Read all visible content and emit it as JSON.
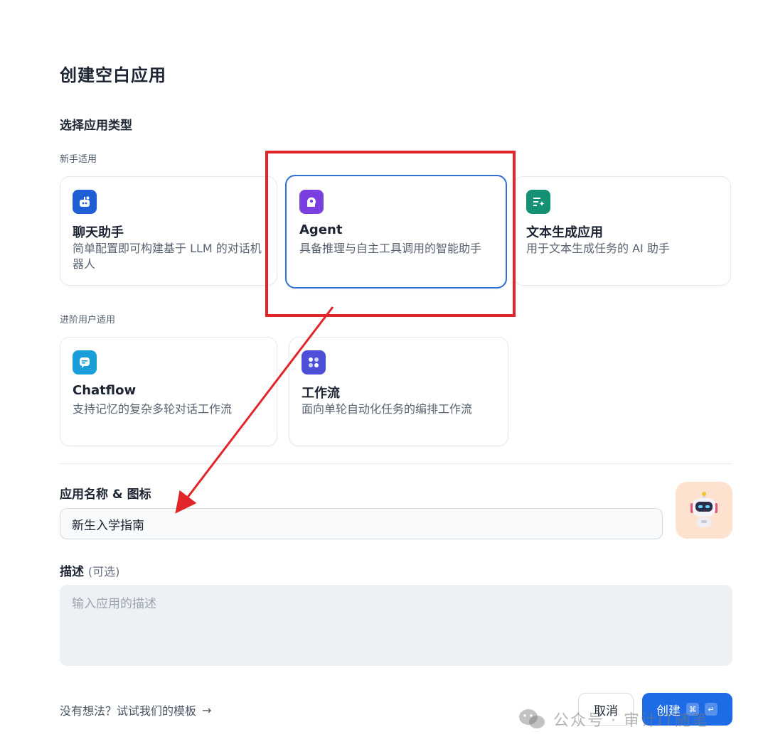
{
  "dialog": {
    "title": "创建空白应用",
    "select_type_label": "选择应用类型"
  },
  "groups": {
    "beginner_label": "新手适用",
    "advanced_label": "进阶用户适用"
  },
  "app_types": [
    {
      "name": "聊天助手",
      "desc": "简单配置即可构建基于 LLM 的对话机器人",
      "icon": "chat-bot-icon",
      "color": "#1f5fd6"
    },
    {
      "name": "Agent",
      "desc": "具备推理与自主工具调用的智能助手",
      "icon": "agent-head-icon",
      "color": "#7b3fe0",
      "selected": true
    },
    {
      "name": "文本生成应用",
      "desc": "用于文本生成任务的 AI 助手",
      "icon": "text-sparkle-icon",
      "color": "#149174"
    },
    {
      "name": "Chatflow",
      "desc": "支持记忆的复杂多轮对话工作流",
      "icon": "chat-flow-icon",
      "color": "#1a9ed9"
    },
    {
      "name": "工作流",
      "desc": "面向单轮自动化任务的编排工作流",
      "icon": "workflow-icon",
      "color": "#4d4fd8"
    }
  ],
  "form": {
    "name_label": "应用名称 & 图标",
    "name_value": "新生入学指南",
    "desc_label": "描述",
    "desc_optional": "(可选)",
    "desc_placeholder": "输入应用的描述"
  },
  "footer": {
    "template_link": "没有想法？试试我们的模板",
    "template_arrow": "→",
    "cancel": "取消",
    "create": "创建",
    "shortcut_cmd": "⌘",
    "shortcut_enter": "↵"
  },
  "watermark": "公众号 · 审计IT随笔",
  "colors": {
    "highlight": "#e0262a",
    "primary": "#1d6ce6",
    "selected_border": "#2f6fd6"
  }
}
